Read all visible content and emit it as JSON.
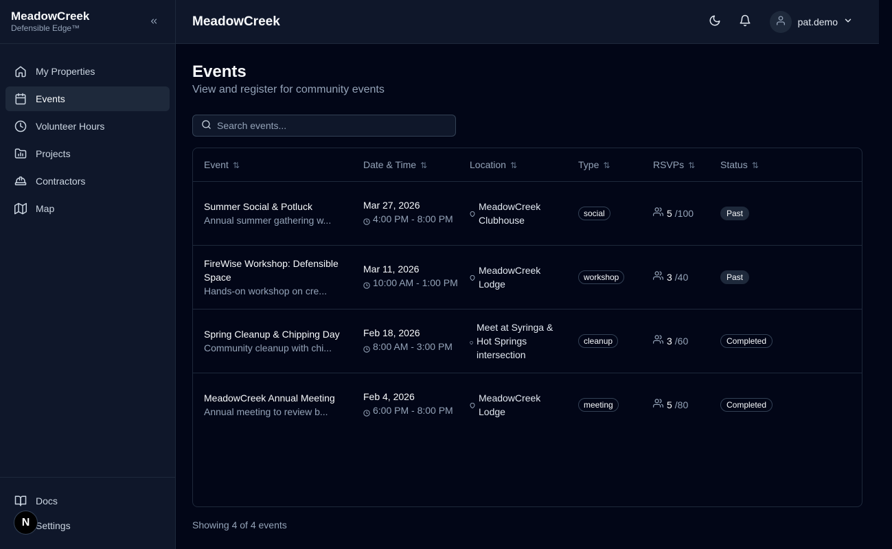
{
  "sidebar": {
    "brand_name": "MeadowCreek",
    "brand_sub": "Defensible Edge™",
    "items": [
      {
        "label": "My Properties",
        "icon": "home-icon"
      },
      {
        "label": "Events",
        "icon": "calendar-icon"
      },
      {
        "label": "Volunteer Hours",
        "icon": "clock-icon"
      },
      {
        "label": "Projects",
        "icon": "folder-chart-icon"
      },
      {
        "label": "Contractors",
        "icon": "hard-hat-icon"
      },
      {
        "label": "Map",
        "icon": "map-icon"
      }
    ],
    "bottom_items": [
      {
        "label": "Docs",
        "icon": "book-icon"
      },
      {
        "label": "Settings",
        "icon": "settings-icon"
      }
    ],
    "n_badge": "N"
  },
  "header": {
    "title": "MeadowCreek",
    "user_name": "pat.demo"
  },
  "main": {
    "title": "Events",
    "subtitle": "View and register for community events",
    "search_placeholder": "Search events...",
    "columns": [
      "Event",
      "Date & Time",
      "Location",
      "Type",
      "RSVPs",
      "Status"
    ],
    "rows": [
      {
        "title": "Summer Social & Potluck",
        "desc": "Annual summer gathering w...",
        "date": "Mar 27, 2026",
        "time": "4:00 PM - 8:00 PM",
        "location": "MeadowCreek Clubhouse",
        "type": "social",
        "rsvp_count": "5",
        "rsvp_max": "/100",
        "status": "Past"
      },
      {
        "title": "FireWise Workshop: Defensible Space",
        "desc": "Hands-on workshop on cre...",
        "date": "Mar 11, 2026",
        "time": "10:00 AM - 1:00 PM",
        "location": "MeadowCreek Lodge",
        "type": "workshop",
        "rsvp_count": "3",
        "rsvp_max": "/40",
        "status": "Past"
      },
      {
        "title": "Spring Cleanup & Chipping Day",
        "desc": "Community cleanup with chi...",
        "date": "Feb 18, 2026",
        "time": "8:00 AM - 3:00 PM",
        "location": "Meet at Syringa & Hot Springs intersection",
        "type": "cleanup",
        "rsvp_count": "3",
        "rsvp_max": "/60",
        "status": "Completed"
      },
      {
        "title": "MeadowCreek Annual Meeting",
        "desc": "Annual meeting to review b...",
        "date": "Feb 4, 2026",
        "time": "6:00 PM - 8:00 PM",
        "location": "MeadowCreek Lodge",
        "type": "meeting",
        "rsvp_count": "5",
        "rsvp_max": "/80",
        "status": "Completed"
      }
    ],
    "footer": "Showing 4 of 4 events"
  }
}
